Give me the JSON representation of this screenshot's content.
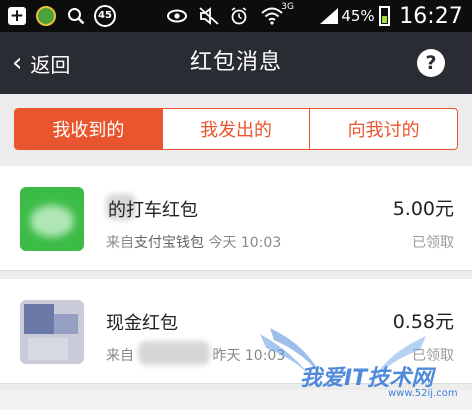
{
  "status_bar": {
    "badge_number": "45",
    "network": "3G",
    "battery_percent": "45%",
    "battery_level": 0.45,
    "time": "16:27"
  },
  "header": {
    "back_label": "返回",
    "title": "红包消息",
    "help_label": "?"
  },
  "tabs": [
    {
      "label": "我收到的",
      "active": true
    },
    {
      "label": "我发出的",
      "active": false
    },
    {
      "label": "向我讨的",
      "active": false
    }
  ],
  "items": [
    {
      "title": "的打车红包",
      "source_prefix": "来自",
      "source": "支付宝钱包",
      "time": "今天 10:03",
      "amount": "5.00元",
      "status": "已领取"
    },
    {
      "title": "现金红包",
      "source_prefix": "来自",
      "source": "",
      "time": "昨天 10:03",
      "amount": "0.58元",
      "status": "已领取"
    }
  ],
  "watermark": {
    "text": "我爱IT技术网",
    "url": "www.52ij.com"
  },
  "colors": {
    "accent": "#e9552e",
    "titlebar": "#2a2c33",
    "statusbar": "#0d0d0d"
  }
}
